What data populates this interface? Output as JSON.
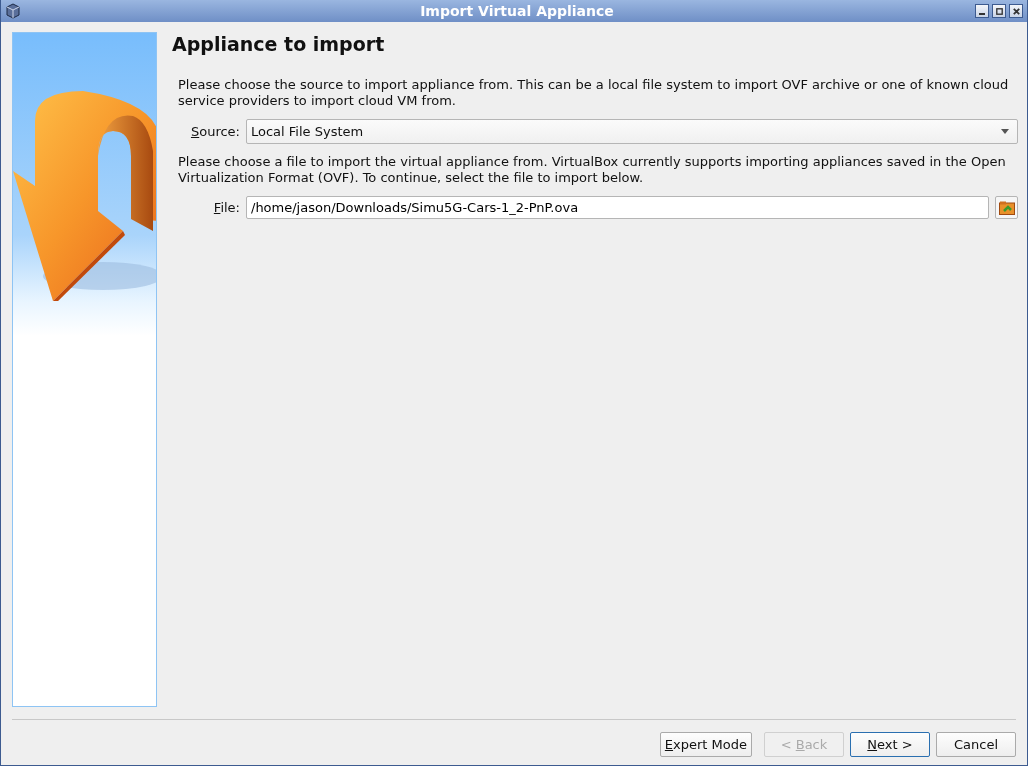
{
  "window": {
    "title": "Import Virtual Appliance"
  },
  "page": {
    "heading": "Appliance to import",
    "source_intro": "Please choose the source to import appliance from. This can be a local file system to import OVF archive or one of known cloud service providers to import cloud VM from.",
    "source": {
      "label": {
        "key": "S",
        "after": "ource:"
      },
      "value": "Local File System"
    },
    "file_intro": "Please choose a file to import the virtual appliance from. VirtualBox currently supports importing appliances saved in the Open Virtualization Format (OVF). To continue, select the file to import below.",
    "file": {
      "label": {
        "key": "F",
        "after": "ile:"
      },
      "value": "/home/jason/Downloads/Simu5G-Cars-1_2-PnP.ova"
    }
  },
  "buttons": [
    {
      "label": {
        "key": "E",
        "after": "xpert Mode"
      },
      "disabled": false,
      "default": false
    },
    {
      "label": {
        "before": "< ",
        "key": "B",
        "after": "ack"
      },
      "disabled": true,
      "default": false
    },
    {
      "label": {
        "key": "N",
        "after": "ext >"
      },
      "disabled": false,
      "default": true
    },
    {
      "label": {
        "before": "Cancel"
      },
      "disabled": false,
      "default": false
    }
  ]
}
